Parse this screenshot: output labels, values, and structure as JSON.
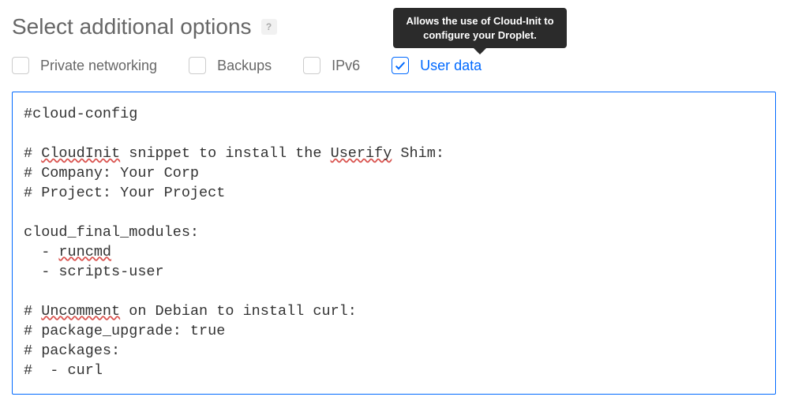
{
  "section": {
    "title": "Select additional options",
    "help_label": "?"
  },
  "tooltip": {
    "text": "Allows the use of Cloud-Init to configure your Droplet."
  },
  "options": {
    "private_networking": {
      "label": "Private networking",
      "checked": false
    },
    "backups": {
      "label": "Backups",
      "checked": false
    },
    "ipv6": {
      "label": "IPv6",
      "checked": false
    },
    "user_data": {
      "label": "User data",
      "checked": true
    }
  },
  "code": {
    "l1": "#cloud-config",
    "l2": "",
    "l3a": "# ",
    "l3b": "CloudInit",
    "l3c": " snippet to install the ",
    "l3d": "Userify",
    "l3e": " Shim:",
    "l4": "# Company: Your Corp",
    "l5": "# Project: Your Project",
    "l6": "",
    "l7": "cloud_final_modules:",
    "l8a": "  - ",
    "l8b": "runcmd",
    "l9": "  - scripts-user",
    "l10": "",
    "l11a": "# ",
    "l11b": "Uncomment",
    "l11c": " on Debian to install curl:",
    "l12": "# package_upgrade: true",
    "l13": "# packages:",
    "l14": "#  - curl"
  }
}
